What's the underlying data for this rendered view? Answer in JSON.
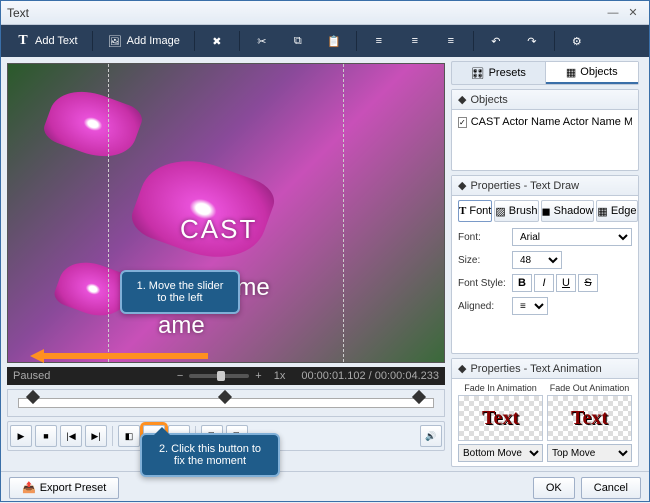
{
  "window": {
    "title": "Text"
  },
  "toolbar": {
    "addText": "Add Text",
    "addImage": "Add Image"
  },
  "preview": {
    "text1": "CAST",
    "text2": "Actor Name",
    "text3": "ame",
    "status": "Paused",
    "zoom": "1x",
    "timePos": "00:00:01.102",
    "timeTotal": "00:00:04.233"
  },
  "callouts": {
    "c1": "1. Move the slider to the left",
    "c2": "2. Click this button to fix the moment"
  },
  "tabs": {
    "presets": "Presets",
    "objects": "Objects"
  },
  "objectsPanel": {
    "title": "Objects",
    "item1": "CAST  Actor Name Actor Name  MUSIC  Music by Na..."
  },
  "propsDraw": {
    "title": "Properties - Text Draw",
    "tabFont": "Font",
    "tabBrush": "Brush",
    "tabShadow": "Shadow",
    "tabEdge": "Edge",
    "fontLabel": "Font:",
    "fontValue": "Arial",
    "sizeLabel": "Size:",
    "sizeValue": "48",
    "styleLabel": "Font Style:",
    "alignLabel": "Aligned:"
  },
  "propsAnim": {
    "title": "Properties - Text Animation",
    "fadeIn": "Fade In Animation",
    "fadeOut": "Fade Out Animation",
    "previewText": "Text",
    "sel1": "Bottom Move",
    "sel2": "Top Move"
  },
  "bottom": {
    "export": "Export Preset",
    "ok": "OK",
    "cancel": "Cancel"
  }
}
